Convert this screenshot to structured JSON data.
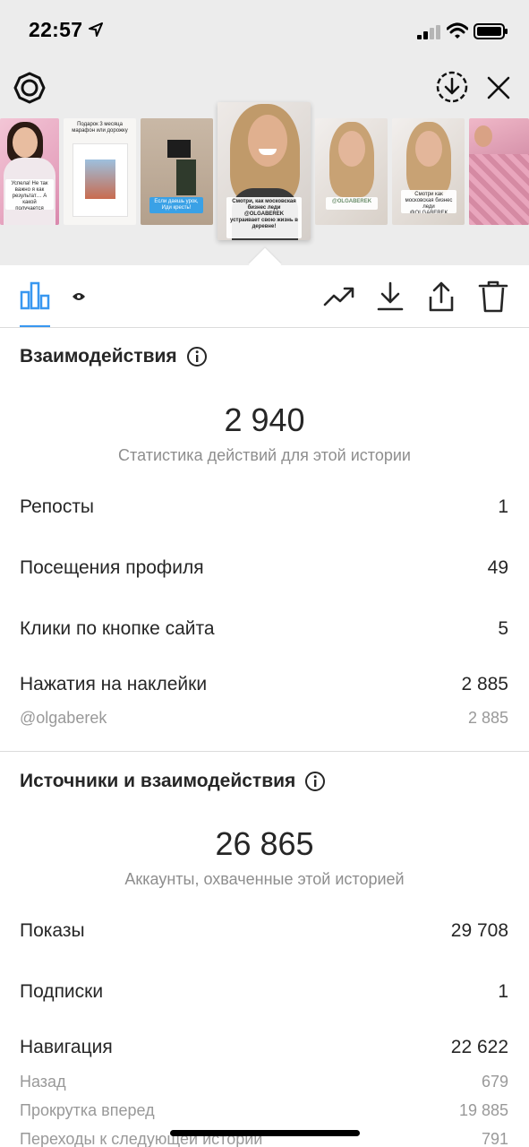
{
  "status_bar": {
    "time": "22:57",
    "icons": [
      "location-arrow-icon",
      "cellular-signal-icon",
      "wifi-icon",
      "battery-icon"
    ]
  },
  "toolbar": {
    "icons": [
      "settings-icon",
      "download-circle-icon",
      "close-icon"
    ]
  },
  "thumbnails": {
    "captions": [
      "Успела! Не так важно я как результат… А какой получается",
      "Подарок 3 месяца марафон или дорожку",
      "Если даешь урок, Иди кресть!",
      "Смотри, как московская бизнес леди @OLGABEREK устраивает свою жизнь в деревне!",
      "@OLGABEREK",
      "Смотри как московская бизнес леди @OLGABEREK",
      ""
    ]
  },
  "tabs": {
    "icons": [
      "bar-chart-icon",
      "eye-icon"
    ],
    "actions": [
      "trending-icon",
      "download-icon",
      "share-icon",
      "trash-icon"
    ]
  },
  "interactions": {
    "title": "Взаимодействия",
    "total": "2 940",
    "caption": "Статистика действий для этой истории",
    "rows": [
      {
        "label": "Репосты",
        "value": "1"
      },
      {
        "label": "Посещения профиля",
        "value": "49"
      },
      {
        "label": "Клики по кнопке сайта",
        "value": "5"
      },
      {
        "label": "Нажатия на наклейки",
        "value": "2 885"
      }
    ],
    "sub_rows": [
      {
        "label": "@olgaberek",
        "value": "2 885"
      }
    ]
  },
  "sources": {
    "title": "Источники и взаимодействия",
    "total": "26 865",
    "caption": "Аккаунты, охваченные этой историей",
    "rows": [
      {
        "label": "Показы",
        "value": "29 708"
      },
      {
        "label": "Подписки",
        "value": "1"
      },
      {
        "label": "Навигация",
        "value": "22 622"
      }
    ],
    "sub_rows": [
      {
        "label": "Назад",
        "value": "679"
      },
      {
        "label": "Прокрутка вперед",
        "value": "19 885"
      },
      {
        "label": "Переходы к следующей истории",
        "value": "791"
      }
    ]
  },
  "colors": {
    "accent": "#3897f0",
    "text": "#262626",
    "secondary_text": "#8e8e8e",
    "header_bg": "#ececec"
  }
}
